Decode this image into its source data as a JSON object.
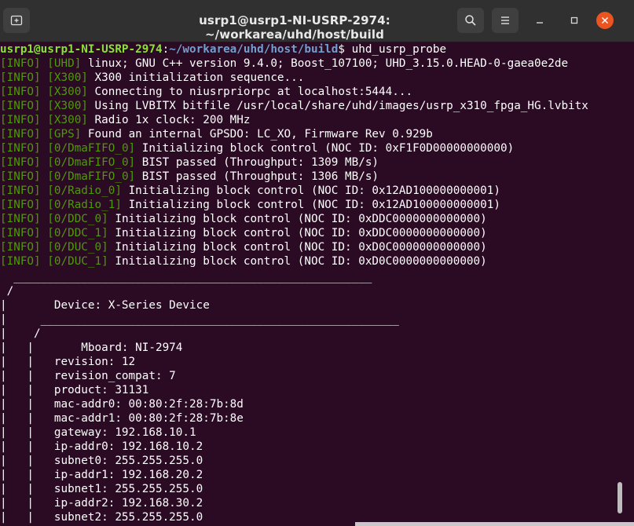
{
  "window": {
    "title": "usrp1@usrp1-NI-USRP-2974: ~/workarea/uhd/host/build"
  },
  "prompt": {
    "user_host": "usrp1@usrp1-NI-USRP-2974",
    "sep": ":",
    "path": "~/workarea/uhd/host/build",
    "symbol": "$ ",
    "command": "uhd_usrp_probe"
  },
  "log_lines": [
    {
      "level": "[INFO]",
      "tag": "[UHD]",
      "msg": "linux; GNU C++ version 9.4.0; Boost_107100; UHD_3.15.0.HEAD-0-gaea0e2de"
    },
    {
      "level": "[INFO]",
      "tag": "[X300]",
      "msg": "X300 initialization sequence..."
    },
    {
      "level": "[INFO]",
      "tag": "[X300]",
      "msg": "Connecting to niusrpriorpc at localhost:5444..."
    },
    {
      "level": "[INFO]",
      "tag": "[X300]",
      "msg": "Using LVBITX bitfile /usr/local/share/uhd/images/usrp_x310_fpga_HG.lvbitx"
    },
    {
      "level": "[INFO]",
      "tag": "[X300]",
      "msg": "Radio 1x clock: 200 MHz"
    },
    {
      "level": "[INFO]",
      "tag": "[GPS]",
      "msg": "Found an internal GPSDO: LC_XO, Firmware Rev 0.929b"
    },
    {
      "level": "[INFO]",
      "tag": "[0/DmaFIFO_0]",
      "msg": "Initializing block control (NOC ID: 0xF1F0D00000000000)"
    },
    {
      "level": "[INFO]",
      "tag": "[0/DmaFIFO_0]",
      "msg": "BIST passed (Throughput: 1309 MB/s)"
    },
    {
      "level": "[INFO]",
      "tag": "[0/DmaFIFO_0]",
      "msg": "BIST passed (Throughput: 1306 MB/s)"
    },
    {
      "level": "[INFO]",
      "tag": "[0/Radio_0]",
      "msg": "Initializing block control (NOC ID: 0x12AD100000000001)"
    },
    {
      "level": "[INFO]",
      "tag": "[0/Radio_1]",
      "msg": "Initializing block control (NOC ID: 0x12AD100000000001)"
    },
    {
      "level": "[INFO]",
      "tag": "[0/DDC_0]",
      "msg": "Initializing block control (NOC ID: 0xDDC0000000000000)"
    },
    {
      "level": "[INFO]",
      "tag": "[0/DDC_1]",
      "msg": "Initializing block control (NOC ID: 0xDDC0000000000000)"
    },
    {
      "level": "[INFO]",
      "tag": "[0/DUC_0]",
      "msg": "Initializing block control (NOC ID: 0xD0C0000000000000)"
    },
    {
      "level": "[INFO]",
      "tag": "[0/DUC_1]",
      "msg": "Initializing block control (NOC ID: 0xD0C0000000000000)"
    }
  ],
  "tree_lines": [
    "  _____________________________________________________",
    " /",
    "|       Device: X-Series Device",
    "|     _____________________________________________________",
    "|    /",
    "|   |       Mboard: NI-2974",
    "|   |   revision: 12",
    "|   |   revision_compat: 7",
    "|   |   product: 31131",
    "|   |   mac-addr0: 00:80:2f:28:7b:8d",
    "|   |   mac-addr1: 00:80:2f:28:7b:8e",
    "|   |   gateway: 192.168.10.1",
    "|   |   ip-addr0: 192.168.10.2",
    "|   |   subnet0: 255.255.255.0",
    "|   |   ip-addr1: 192.168.20.2",
    "|   |   subnet1: 255.255.255.0",
    "|   |   ip-addr2: 192.168.30.2",
    "|   |   subnet2: 255.255.255.0"
  ],
  "colors": {
    "background": "#2b0a23",
    "prompt_user": "#8ae234",
    "prompt_path": "#729fcf",
    "info_tag": "#4e9a06",
    "close_button": "#e95420"
  },
  "icons": {
    "new_tab": "new-tab-icon",
    "search": "search-icon",
    "menu": "hamburger-menu-icon",
    "minimize": "minimize-icon",
    "maximize": "maximize-icon",
    "close": "close-icon"
  }
}
